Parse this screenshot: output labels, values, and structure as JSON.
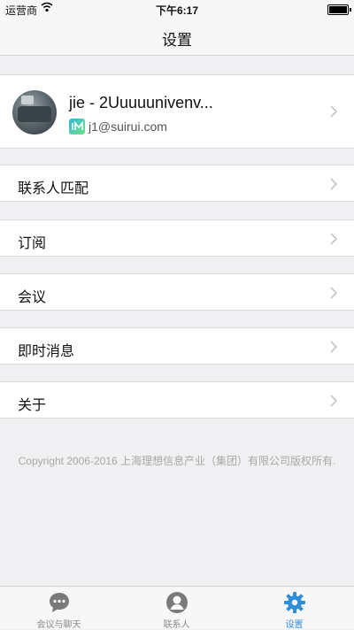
{
  "status_bar": {
    "carrier": "运营商",
    "time": "下午6:17",
    "icons": [
      "wifi-icon",
      "battery-icon"
    ]
  },
  "nav": {
    "title": "设置"
  },
  "profile": {
    "name": "jie - 2Uuuuunivenv...",
    "email": "j1@suirui.com",
    "email_icon": "suirui-app-icon"
  },
  "menu": [
    {
      "label": "联系人匹配"
    },
    {
      "label": "订阅"
    },
    {
      "label": "会议"
    },
    {
      "label": "即时消息"
    },
    {
      "label": "关于"
    }
  ],
  "footer": {
    "copyright": "Copyright 2006-2016 上海理想信息产业（集团）有限公司版权所有."
  },
  "tabs": [
    {
      "label": "会议与聊天",
      "icon": "chat-bubble-icon",
      "active": false
    },
    {
      "label": "联系人",
      "icon": "person-icon",
      "active": false
    },
    {
      "label": "设置",
      "icon": "gear-icon",
      "active": true
    }
  ],
  "colors": {
    "accent": "#2e8fd8",
    "background": "#f0f0f2",
    "inactive_tab": "#8a8a8a"
  }
}
